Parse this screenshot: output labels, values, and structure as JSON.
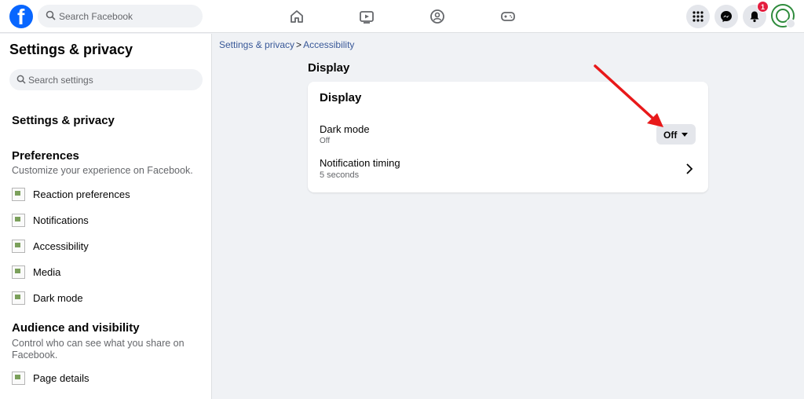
{
  "topbar": {
    "logo_letter": "f",
    "search_placeholder": "Search Facebook",
    "notification_count": "1"
  },
  "sidebar": {
    "title": "Settings & privacy",
    "search_placeholder": "Search settings",
    "section_main": "Settings & privacy",
    "preferences": {
      "heading": "Preferences",
      "description": "Customize your experience on Facebook.",
      "items": [
        {
          "label": "Reaction preferences"
        },
        {
          "label": "Notifications"
        },
        {
          "label": "Accessibility"
        },
        {
          "label": "Media"
        },
        {
          "label": "Dark mode"
        }
      ]
    },
    "audience": {
      "heading": "Audience and visibility",
      "description": "Control who can see what you share on Facebook.",
      "items": [
        {
          "label": "Page details"
        }
      ]
    }
  },
  "main": {
    "breadcrumb": {
      "root": "Settings & privacy",
      "separator": ">",
      "current": "Accessibility"
    },
    "section_title": "Display",
    "card": {
      "title": "Display",
      "dark_mode": {
        "label": "Dark mode",
        "status": "Off",
        "dropdown_value": "Off"
      },
      "notification_timing": {
        "label": "Notification timing",
        "value": "5 seconds"
      }
    }
  },
  "colors": {
    "brand_blue": "#0866ff",
    "annotation_red": "#e8191a",
    "badge_red": "#e41e3f"
  }
}
